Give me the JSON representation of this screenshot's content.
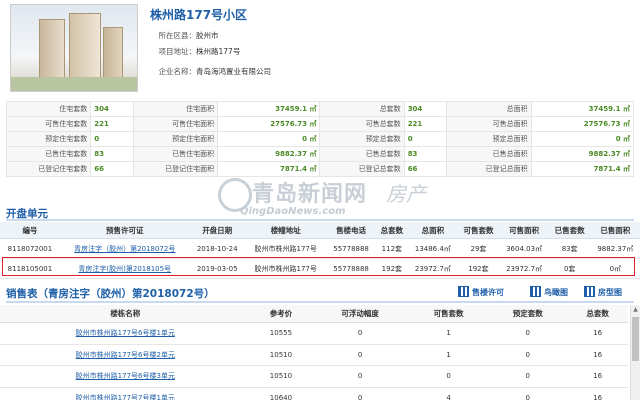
{
  "project": {
    "title": "株州路177号小区",
    "district_label": "所在区县：",
    "district": "胶州市",
    "address_label": "项目地址：",
    "address": "株州路177号",
    "company_label": "企业名称：",
    "company": "青岛海鸿置业有限公司"
  },
  "summary": [
    [
      "住宅套数",
      "304",
      "住宅面积",
      "37459.1 ㎡",
      "总套数",
      "304",
      "总面积",
      "37459.1 ㎡"
    ],
    [
      "可售住宅套数",
      "221",
      "可售住宅面积",
      "27576.73 ㎡",
      "可售总套数",
      "221",
      "可售总面积",
      "27576.73 ㎡"
    ],
    [
      "预定住宅套数",
      "0",
      "预定住宅面积",
      "0 ㎡",
      "预定总套数",
      "0",
      "预定总面积",
      "0 ㎡"
    ],
    [
      "已售住宅套数",
      "83",
      "已售住宅面积",
      "9882.37 ㎡",
      "已售总套数",
      "83",
      "已售总面积",
      "9882.37 ㎡"
    ],
    [
      "已登记住宅套数",
      "66",
      "已登记住宅面积",
      "7871.4 ㎡",
      "已登记总套数",
      "66",
      "已登记总面积",
      "7871.4 ㎡"
    ]
  ],
  "watermark": {
    "big": "青岛新闻网",
    "small": "QingDaoNews.com",
    "extra": "房产"
  },
  "open_units": {
    "title": "开盘单元",
    "headers": [
      "编号",
      "预售许可证",
      "开盘日期",
      "楼幢地址",
      "售楼电话",
      "总套数",
      "总面积",
      "可售套数",
      "可售面积",
      "已售套数",
      "已售面积"
    ],
    "rows": [
      [
        "8118072001",
        "青房注字（胶州）第2018072号",
        "2018-10-24",
        "胶州市株州路177号",
        "55778888",
        "112套",
        "13486.4㎡",
        "29套",
        "3604.03㎡",
        "83套",
        "9882.37㎡"
      ],
      [
        "8118105001",
        "青房注字(胶州)第2018105号",
        "2019-03-05",
        "胶州市株州路177号",
        "55778888",
        "192套",
        "23972.7㎡",
        "192套",
        "23972.7㎡",
        "0套",
        "0㎡"
      ]
    ]
  },
  "sales": {
    "title": "销售表（青房注字（胶州）第2018072号）",
    "tools": [
      "售楼许可",
      "鸟瞰图",
      "房型图"
    ],
    "headers": [
      "楼栋名称",
      "参考价",
      "可浮动幅度",
      "可售套数",
      "预定套数",
      "总套数"
    ],
    "rows": [
      [
        "胶州市株州路177号6号楼1单元",
        "10555",
        "0",
        "1",
        "0",
        "16"
      ],
      [
        "胶州市株州路177号6号楼2单元",
        "10510",
        "0",
        "1",
        "0",
        "16"
      ],
      [
        "胶州市株州路177号6号楼3单元",
        "10510",
        "0",
        "0",
        "0",
        "16"
      ],
      [
        "胶州市株州路177号7号楼1单元",
        "10640",
        "0",
        "4",
        "0",
        "16"
      ]
    ]
  }
}
